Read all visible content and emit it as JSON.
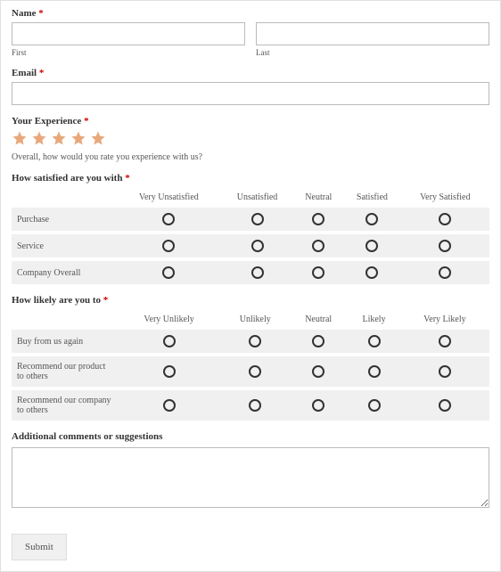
{
  "name": {
    "label": "Name",
    "first_sublabel": "First",
    "last_sublabel": "Last"
  },
  "email": {
    "label": "Email"
  },
  "experience": {
    "label": "Your Experience",
    "help": "Overall, how would you rate you experience with us?"
  },
  "satisfaction": {
    "label": "How satisfied are you with",
    "headers": [
      "",
      "Very Unsatisfied",
      "Unsatisfied",
      "Neutral",
      "Satisfied",
      "Very Satisfied"
    ],
    "rows": [
      "Purchase",
      "Service",
      "Company Overall"
    ]
  },
  "likelihood": {
    "label": "How likely are you to",
    "headers": [
      "",
      "Very Unlikely",
      "Unlikely",
      "Neutral",
      "Likely",
      "Very Likely"
    ],
    "rows": [
      "Buy from us again",
      "Recommend our product to others",
      "Recommend our company to others"
    ]
  },
  "comments": {
    "label": "Additional comments or suggestions"
  },
  "submit": {
    "label": "Submit"
  }
}
